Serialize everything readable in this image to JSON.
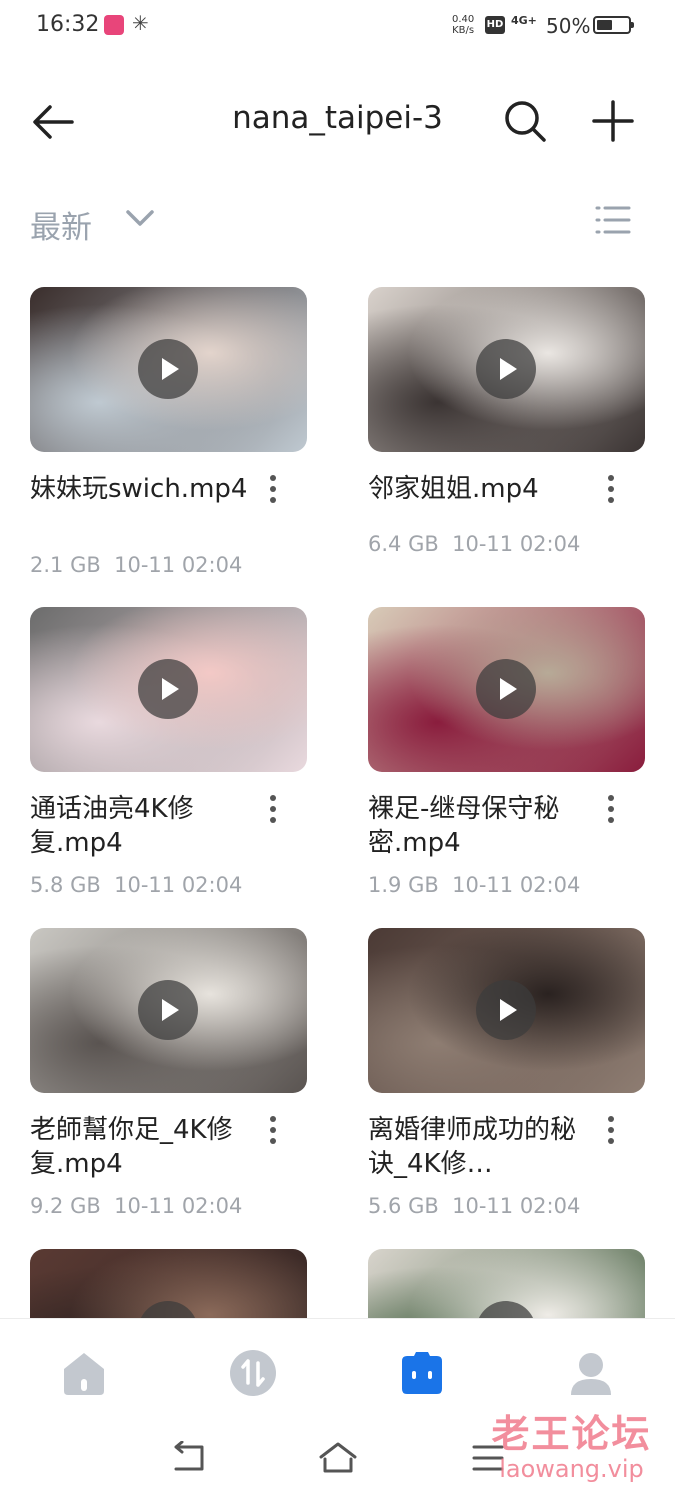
{
  "status_bar": {
    "time": "16:32",
    "speed_value": "0.40",
    "speed_unit": "KB/s",
    "hd": "HD",
    "signal": "4G+",
    "battery": "50%",
    "battery_level": 0.5
  },
  "header": {
    "title": "nana_taipei-3",
    "back_icon": "arrow-left-icon",
    "search_icon": "search-icon",
    "add_icon": "plus-icon"
  },
  "sort": {
    "label": "最新",
    "view_icon": "list-view-icon"
  },
  "files": [
    {
      "title": "妹妹玩swich.mp4",
      "size": "2.1 GB",
      "date": "10-11 02:04",
      "thumb": [
        "#3a2e2c",
        "#bfc9d1",
        "#e3d4cc"
      ]
    },
    {
      "title": "邻家姐姐.mp4",
      "size": "6.4 GB",
      "date": "10-11 02:04",
      "thumb": [
        "#d9d2cc",
        "#3b3433",
        "#eae6e2"
      ]
    },
    {
      "title": "通话油亮4K修复.mp4",
      "size": "5.8 GB",
      "date": "10-11 02:04",
      "thumb": [
        "#6c6c6c",
        "#e9d9de",
        "#f3c9c6"
      ]
    },
    {
      "title": "裸足-继母保守秘密.mp4",
      "size": "1.9 GB",
      "date": "10-11 02:04",
      "thumb": [
        "#d8cbb8",
        "#8a1d3d",
        "#b7aa97"
      ]
    },
    {
      "title": "老師幫你足_4K修复.mp4",
      "size": "9.2 GB",
      "date": "10-11 02:04",
      "thumb": [
        "#c9c7c2",
        "#5a5451",
        "#e7e3dd"
      ]
    },
    {
      "title": "离婚律师成功的秘诀_4K修…",
      "size": "5.6 GB",
      "date": "10-11 02:04",
      "thumb": [
        "#4b3a35",
        "#8e7d72",
        "#2a2220"
      ]
    },
    {
      "title": "",
      "size": "",
      "date": "",
      "thumb": [
        "#5a3a33",
        "#2b2120",
        "#8b6a5a"
      ]
    },
    {
      "title": "",
      "size": "",
      "date": "",
      "thumb": [
        "#d8d4cc",
        "#3c5a3a",
        "#efece7"
      ]
    }
  ],
  "bottom_nav": [
    {
      "icon": "home-icon",
      "color": "#c3c8cf"
    },
    {
      "icon": "transfer-icon",
      "color": "#c3c8cf"
    },
    {
      "icon": "files-icon",
      "color": "#1a74e8"
    },
    {
      "icon": "profile-icon",
      "color": "#c3c8cf"
    }
  ],
  "system_nav": [
    "back-gesture-icon",
    "home-gesture-icon",
    "menu-gesture-icon"
  ],
  "watermark": {
    "cn": "老王论坛",
    "en": "laowang.vip"
  },
  "colors": {
    "accent": "#1a74e8",
    "meta_text": "#a0a4aa",
    "watermark": "#f07b8c"
  }
}
